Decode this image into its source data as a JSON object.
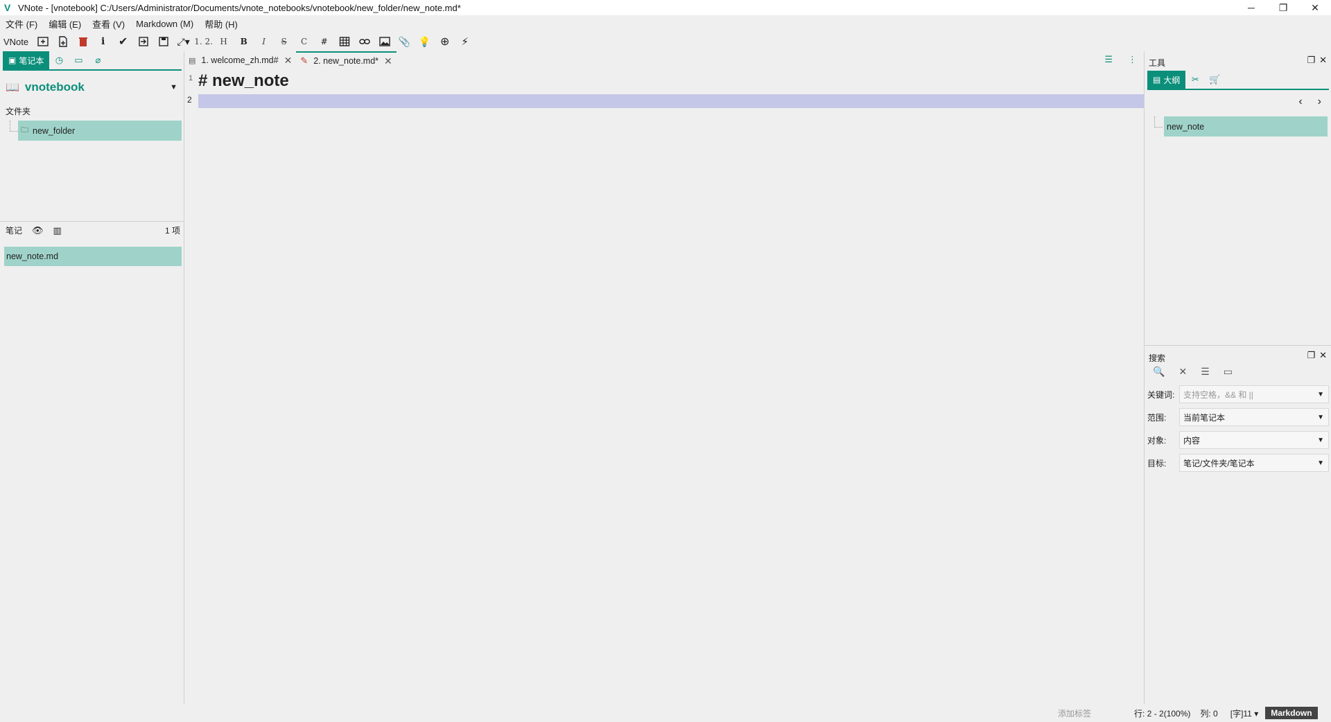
{
  "window": {
    "logo": "V",
    "title": "VNote - [vnotebook] C:/Users/Administrator/Documents/vnote_notebooks/vnotebook/new_folder/new_note.md*",
    "minimize": "─",
    "restore": "❐",
    "close": "✕"
  },
  "menu": [
    "文件 (F)",
    "编辑 (E)",
    "查看 (V)",
    "Markdown (M)",
    "帮助 (H)"
  ],
  "toolbar": {
    "app_label": "VNote",
    "ordered_list": "1. 2.",
    "heading": "H",
    "bold": "B",
    "italic": "I",
    "strike": "S",
    "code": "C",
    "tag": "#"
  },
  "left_panel": {
    "active_tab": "笔记本",
    "notebook_name": "vnotebook",
    "folders_label": "文件夹",
    "folder": "new_folder",
    "notes_label": "笔记",
    "notes_count": "1 项",
    "note": "new_note.md"
  },
  "editor": {
    "tabs": [
      {
        "label": "1. welcome_zh.md#"
      },
      {
        "label": "2. new_note.md*"
      }
    ],
    "line1_no": "1",
    "line2_no": "2",
    "heading_text": "# new_note"
  },
  "right_panel": {
    "tools_title": "工具",
    "outline_tab": "大纲",
    "outline_item": "new_note",
    "search_title": "搜索",
    "keyword_label": "关键词:",
    "keyword_placeholder": "支持空格，&& 和 ||",
    "scope_label": "范围:",
    "scope_value": "当前笔记本",
    "object_label": "对象:",
    "object_value": "内容",
    "target_label": "目标:",
    "target_value": "笔记/文件夹/笔记本"
  },
  "status": {
    "add_tag": "添加标签",
    "position": "行: 2 - 2(100%)",
    "column": "列: 0",
    "word_count": "[字]11 ▾",
    "mode": "Markdown"
  }
}
